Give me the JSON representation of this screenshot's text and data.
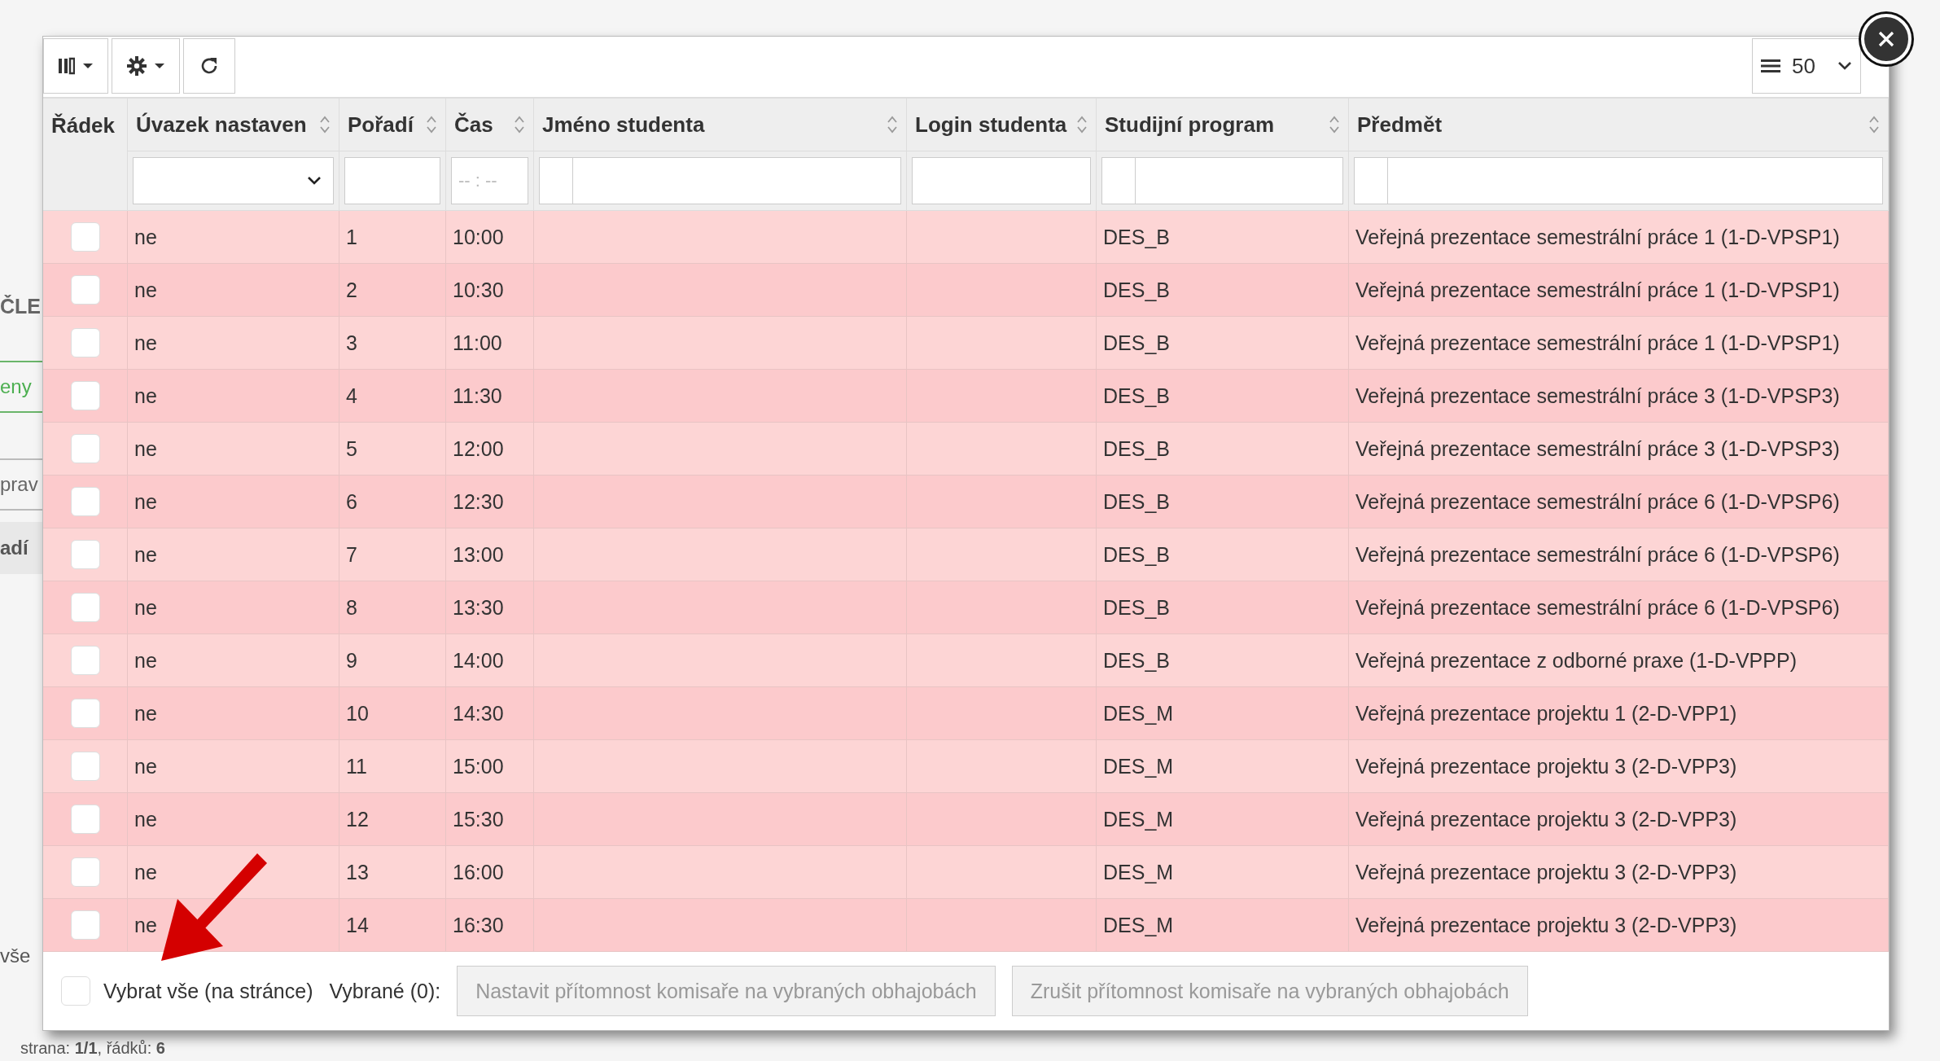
{
  "background_page": {
    "heading": "ČLE",
    "tab": "eny",
    "field": "prav",
    "column_header": "adí",
    "select_all": "vše",
    "pager": "strana: **1/1**, řádků: **6**"
  },
  "dialog": {
    "toolbar": {
      "page_size": "50"
    },
    "columns": [
      {
        "label": "Řádek",
        "sortable": false
      },
      {
        "label": "Úvazek nastaven",
        "sortable": true,
        "filter": {
          "kind": "select"
        }
      },
      {
        "label": "Pořadí",
        "sortable": true,
        "filter": {
          "kind": "text"
        }
      },
      {
        "label": "Čas",
        "sortable": true,
        "filter": {
          "kind": "time",
          "placeholder": "-- : --"
        }
      },
      {
        "label": "Jméno studenta",
        "sortable": true,
        "filter": {
          "kind": "split"
        }
      },
      {
        "label": "Login studenta",
        "sortable": true,
        "filter": {
          "kind": "text"
        }
      },
      {
        "label": "Studijní program",
        "sortable": true,
        "filter": {
          "kind": "split"
        }
      },
      {
        "label": "Předmět",
        "sortable": true,
        "filter": {
          "kind": "split"
        }
      }
    ],
    "rows": [
      {
        "selected": false,
        "commitment": "ne",
        "order": "1",
        "time": "10:00",
        "program": "DES_B",
        "course": "Veřejná prezentace semestrální práce 1 (1-D-VPSP1)"
      },
      {
        "selected": false,
        "commitment": "ne",
        "order": "2",
        "time": "10:30",
        "program": "DES_B",
        "course": "Veřejná prezentace semestrální práce 1 (1-D-VPSP1)"
      },
      {
        "selected": false,
        "commitment": "ne",
        "order": "3",
        "time": "11:00",
        "program": "DES_B",
        "course": "Veřejná prezentace semestrální práce 1 (1-D-VPSP1)"
      },
      {
        "selected": false,
        "commitment": "ne",
        "order": "4",
        "time": "11:30",
        "program": "DES_B",
        "course": "Veřejná prezentace semestrální práce 3 (1-D-VPSP3)"
      },
      {
        "selected": false,
        "commitment": "ne",
        "order": "5",
        "time": "12:00",
        "program": "DES_B",
        "course": "Veřejná prezentace semestrální práce 3 (1-D-VPSP3)"
      },
      {
        "selected": false,
        "commitment": "ne",
        "order": "6",
        "time": "12:30",
        "program": "DES_B",
        "course": "Veřejná prezentace semestrální práce 6 (1-D-VPSP6)"
      },
      {
        "selected": false,
        "commitment": "ne",
        "order": "7",
        "time": "13:00",
        "program": "DES_B",
        "course": "Veřejná prezentace semestrální práce 6 (1-D-VPSP6)"
      },
      {
        "selected": false,
        "commitment": "ne",
        "order": "8",
        "time": "13:30",
        "program": "DES_B",
        "course": "Veřejná prezentace semestrální práce 6 (1-D-VPSP6)"
      },
      {
        "selected": false,
        "commitment": "ne",
        "order": "9",
        "time": "14:00",
        "program": "DES_B",
        "course": "Veřejná prezentace z odborné praxe (1-D-VPPP)"
      },
      {
        "selected": false,
        "commitment": "ne",
        "order": "10",
        "time": "14:30",
        "program": "DES_M",
        "course": "Veřejná prezentace projektu 1 (2-D-VPP1)"
      },
      {
        "selected": false,
        "commitment": "ne",
        "order": "11",
        "time": "15:00",
        "program": "DES_M",
        "course": "Veřejná prezentace projektu 3 (2-D-VPP3)"
      },
      {
        "selected": false,
        "commitment": "ne",
        "order": "12",
        "time": "15:30",
        "program": "DES_M",
        "course": "Veřejná prezentace projektu 3 (2-D-VPP3)"
      },
      {
        "selected": false,
        "commitment": "ne",
        "order": "13",
        "time": "16:00",
        "program": "DES_M",
        "course": "Veřejná prezentace projektu 3 (2-D-VPP3)"
      },
      {
        "selected": false,
        "commitment": "ne",
        "order": "14",
        "time": "16:30",
        "program": "DES_M",
        "course": "Veřejná prezentace projektu 3 (2-D-VPP3)"
      }
    ],
    "footer": {
      "select_all": {
        "label": "Vybrat vše (na stránce)",
        "checked": false
      },
      "selected_label": "Vybrané (0):",
      "buttons": [
        {
          "label": "Nastavit přítomnost komisaře na vybraných obhajobách",
          "disabled": true
        },
        {
          "label": "Zrušit přítomnost komisaře na vybraných obhajobách",
          "disabled": true
        }
      ]
    }
  }
}
